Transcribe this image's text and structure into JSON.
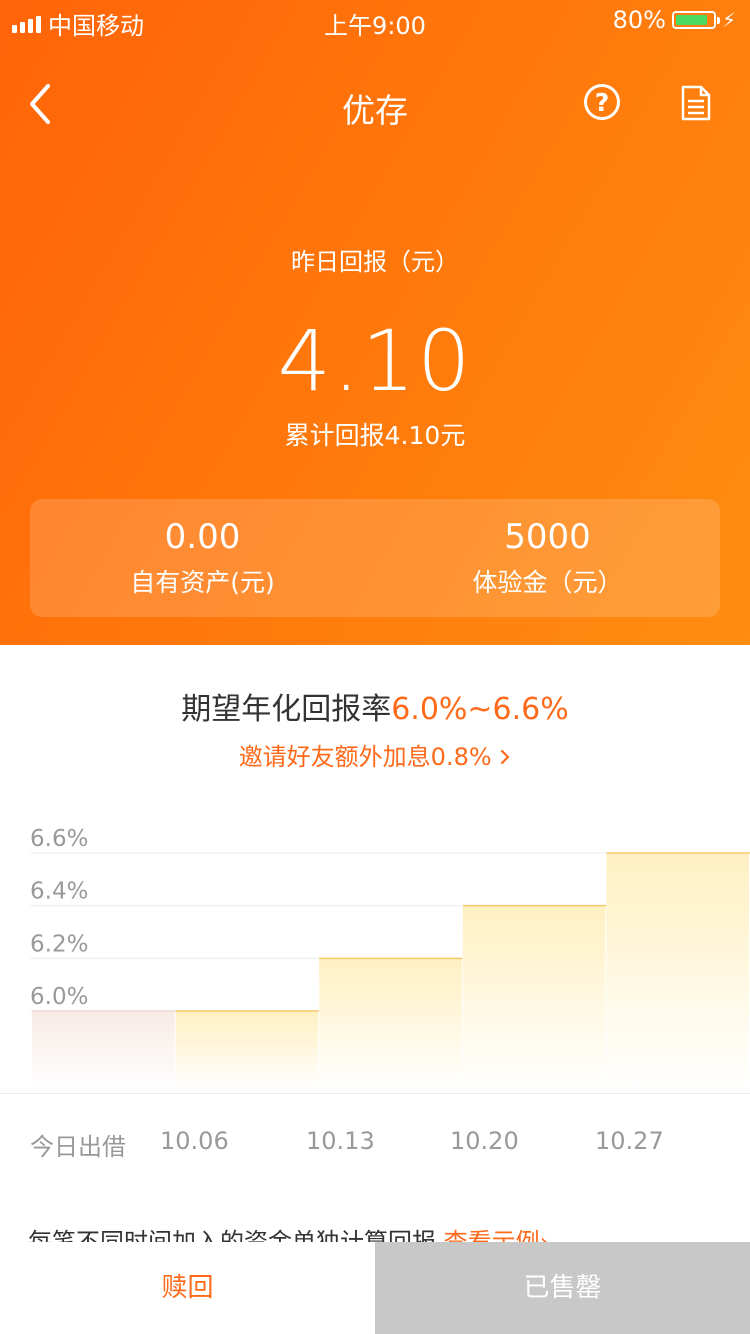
{
  "status_bar": {
    "carrier": "中国移动",
    "time": "上午9:00",
    "battery": "80%",
    "battery_level": 0.8
  },
  "nav": {
    "title": "优存",
    "help_icon": "question-circle-icon",
    "doc_icon": "document-icon",
    "back_icon": "chevron-left-icon"
  },
  "summary": {
    "yesterday_label": "昨日回报（元）",
    "yesterday_value": "4.10",
    "total_text": "累计回报4.10元",
    "own_assets_value": "0.00",
    "own_assets_label": "自有资产(元)",
    "trial_value": "5000",
    "trial_label": "体验金（元）"
  },
  "rate": {
    "prefix": "期望年化回报率",
    "range": "6.0%~6.6%",
    "invite_text": "邀请好友额外加息0.8%"
  },
  "chart_data": {
    "type": "bar",
    "categories": [
      "今日出借",
      "10.06",
      "10.13",
      "10.20",
      "10.27"
    ],
    "values": [
      6.0,
      6.0,
      6.2,
      6.4,
      6.6
    ],
    "ytick_labels": [
      "6.6%",
      "6.4%",
      "6.2%",
      "6.0%"
    ],
    "yticks": [
      6.6,
      6.4,
      6.2,
      6.0
    ],
    "ylim": [
      5.7,
      6.6
    ],
    "grid": true
  },
  "footnote": {
    "text": "每笔不同时间加入的资金单独计算回报",
    "link": "查看示例"
  },
  "actions": {
    "redeem": "赎回",
    "sold_out": "已售罄"
  },
  "colors": {
    "header_start": "#ff6408",
    "header_end": "#ff8d12",
    "accent": "#ff6a1a",
    "disabled": "#c8c8c8"
  }
}
